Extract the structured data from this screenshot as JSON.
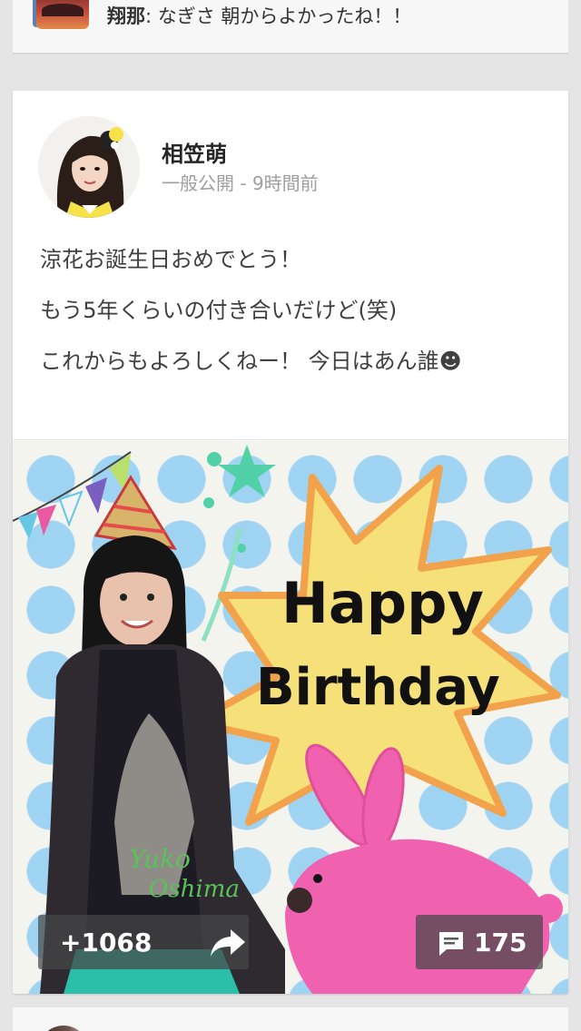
{
  "previous_post": {
    "author": "翔那",
    "text": ": なぎさ 朝からよかったね！！"
  },
  "post": {
    "author_name": "相笠萌",
    "visibility": "一般公開",
    "time": "9時間前",
    "separator": " - ",
    "lines": [
      "涼花お誕生日おめでとう！",
      "もう5年くらいの付き合いだけど(笑)",
      "これからもよろしくねー！ 今日はあん誰☻"
    ],
    "image": {
      "caption_line1": "Happy",
      "caption_line2": "Birthday",
      "shirt_text_line1": "Yuko",
      "shirt_text_line2": "Oshima"
    },
    "plus_count": "+1068",
    "comment_count": "175"
  },
  "icons": {
    "share": "share-arrow-icon",
    "comment": "comment-bubble-icon"
  },
  "colors": {
    "background": "#e5e5e5",
    "card": "#ffffff",
    "meta_text": "#9e9e9e",
    "dots": "#9fd3f2",
    "bunny": "#f062b0",
    "star": "#f6e07a"
  }
}
